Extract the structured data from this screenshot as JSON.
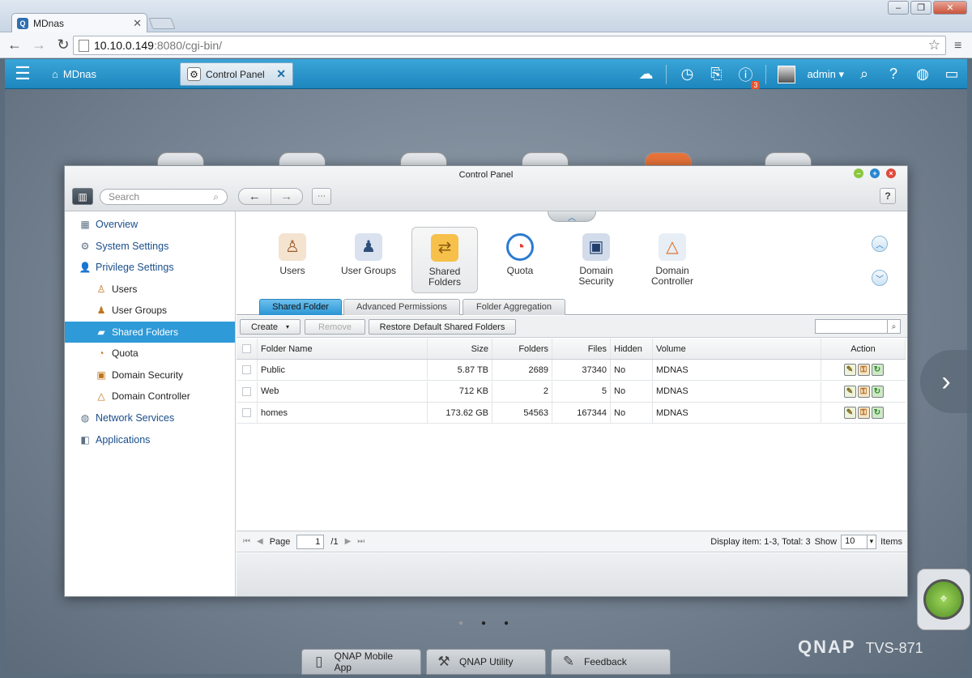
{
  "browser": {
    "tab_title": "MDnas",
    "url_host": "10.10.0.149",
    "url_rest": ":8080/cgi-bin/"
  },
  "qts": {
    "home_label": "MDnas",
    "app_tab_label": "Control Panel",
    "notification_count": "3",
    "username": "admin"
  },
  "window": {
    "title": "Control Panel",
    "search_placeholder": "Search"
  },
  "sidebar": {
    "items": [
      {
        "label": "Overview",
        "icon": "overview-icon"
      },
      {
        "label": "System Settings",
        "icon": "gear-icon"
      },
      {
        "label": "Privilege Settings",
        "icon": "person-icon"
      },
      {
        "label": "Users",
        "icon": "user-icon"
      },
      {
        "label": "User Groups",
        "icon": "user-groups-icon"
      },
      {
        "label": "Shared Folders",
        "icon": "folder-icon"
      },
      {
        "label": "Quota",
        "icon": "quota-icon"
      },
      {
        "label": "Domain Security",
        "icon": "domain-security-icon"
      },
      {
        "label": "Domain Controller",
        "icon": "domain-controller-icon"
      },
      {
        "label": "Network Services",
        "icon": "globe-icon"
      },
      {
        "label": "Applications",
        "icon": "applications-icon"
      }
    ],
    "selected": "Shared Folders"
  },
  "apps": [
    {
      "label": "Users",
      "icon": "user-icon"
    },
    {
      "label": "User Groups",
      "icon": "user-groups-icon"
    },
    {
      "label": "Shared Folders",
      "icon": "shared-folder-icon"
    },
    {
      "label": "Quota",
      "icon": "quota-icon"
    },
    {
      "label": "Domain Security",
      "icon": "domain-security-icon"
    },
    {
      "label": "Domain Controller",
      "icon": "domain-controller-icon"
    }
  ],
  "subtabs": [
    "Shared Folder",
    "Advanced Permissions",
    "Folder Aggregation"
  ],
  "grid_toolbar": {
    "create": "Create",
    "remove": "Remove",
    "restore": "Restore Default Shared Folders"
  },
  "table": {
    "headers": [
      "Folder Name",
      "Size",
      "Folders",
      "Files",
      "Hidden",
      "Volume",
      "Action"
    ],
    "rows": [
      {
        "name": "Public",
        "size": "5.87 TB",
        "folders": "2689",
        "files": "37340",
        "hidden": "No",
        "volume": "MDNAS"
      },
      {
        "name": "Web",
        "size": "712 KB",
        "folders": "2",
        "files": "5",
        "hidden": "No",
        "volume": "MDNAS"
      },
      {
        "name": "homes",
        "size": "173.62 GB",
        "folders": "54563",
        "files": "167344",
        "hidden": "No",
        "volume": "MDNAS"
      }
    ]
  },
  "pager": {
    "page_label": "Page",
    "page_value": "1",
    "page_total": "/1",
    "display": "Display item: 1-3, Total: 3",
    "show_label": "Show",
    "show_value": "10",
    "items_label": "Items"
  },
  "dock": [
    {
      "label": "QNAP Mobile App",
      "icon": "mobile-icon"
    },
    {
      "label": "QNAP Utility",
      "icon": "hammer-icon"
    },
    {
      "label": "Feedback",
      "icon": "edit-icon"
    }
  ],
  "brand": {
    "name": "QNAP",
    "model": "TVS-871"
  }
}
